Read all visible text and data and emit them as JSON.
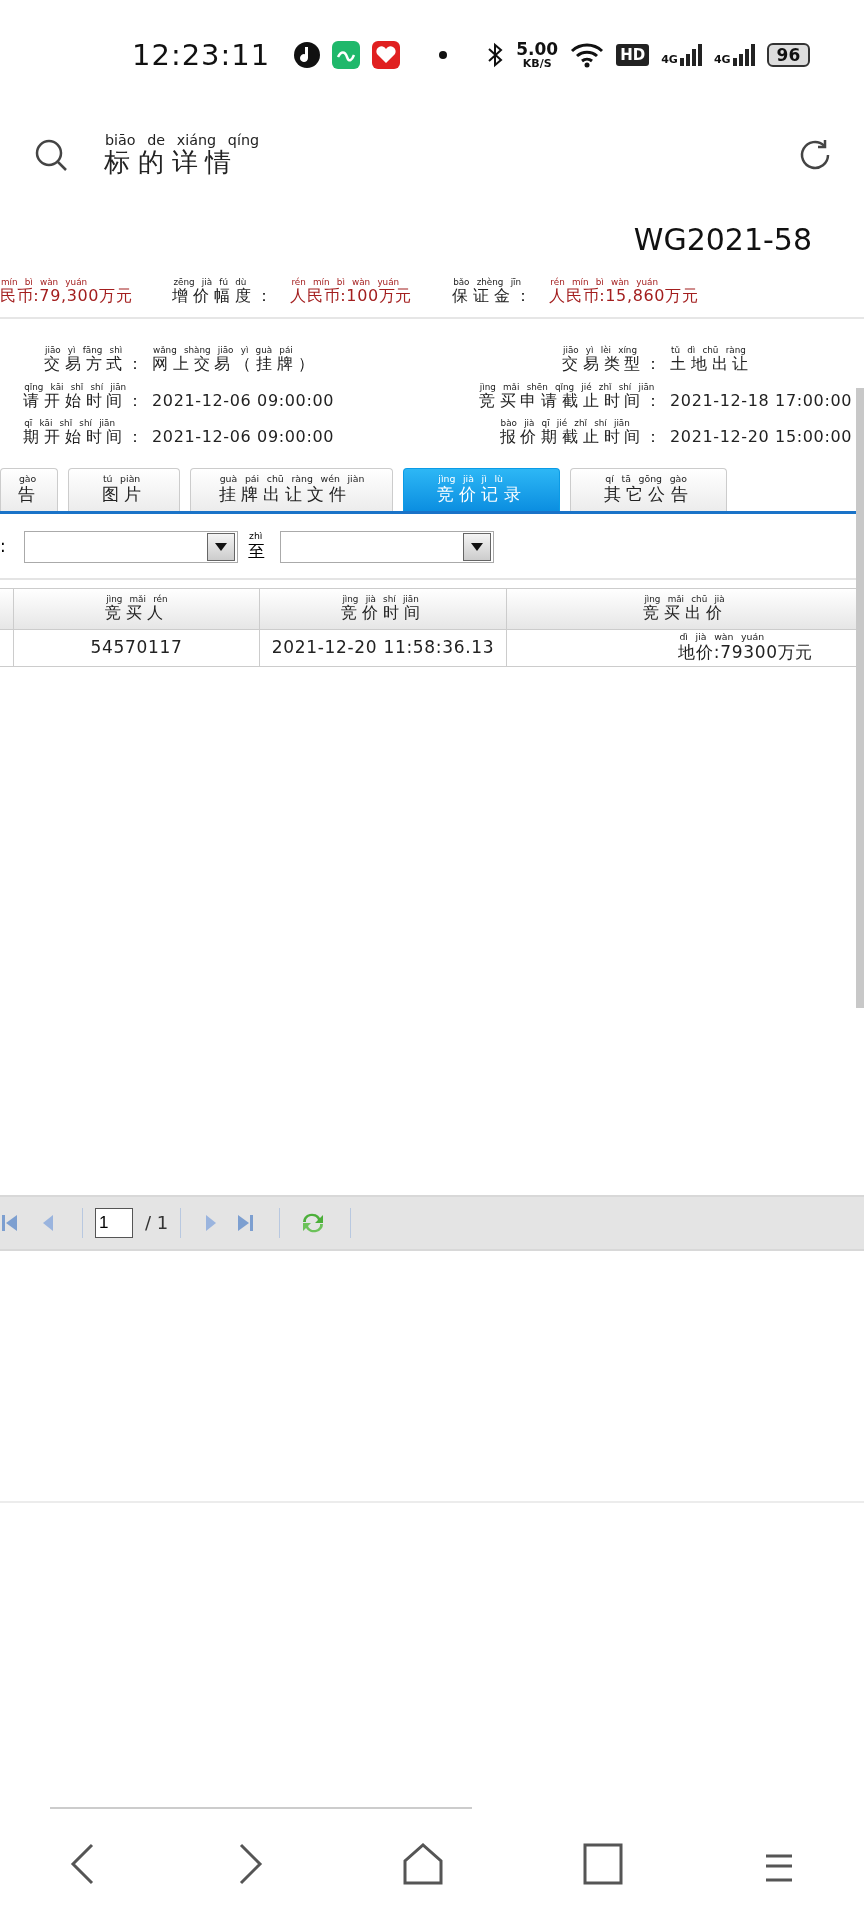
{
  "status_bar": {
    "time": "12:23:11",
    "net_speed": "5.00",
    "net_unit": "KB/S",
    "hd": "HD",
    "signals": [
      "4G",
      "4G"
    ],
    "battery": "96"
  },
  "header": {
    "title": {
      "text": "标的详情",
      "pinyin": "biāo de xiáng qíng"
    }
  },
  "lot_number": "WG2021-58",
  "prices": [
    {
      "value": {
        "text": "民币:79,300万元",
        "pinyin": "mín bì wàn yuán"
      }
    },
    {
      "label": {
        "text": "增价幅度：",
        "pinyin": "zēng jià fú dù"
      },
      "value": {
        "text": "人民币:100万元",
        "pinyin": "rén mín bì wàn yuán"
      }
    },
    {
      "label": {
        "text": "保证金：",
        "pinyin": "bǎo zhèng jīn"
      },
      "value": {
        "text": "人民币:15,860万元",
        "pinyin": "rén mín bì wàn yuán"
      }
    }
  ],
  "info": [
    {
      "label": {
        "text": "交易方式：",
        "pinyin": "jiāo yì fāng shì"
      },
      "value": {
        "text": "网上交易（挂牌）",
        "pinyin": "wǎng shàng jiāo yì guà pái"
      }
    },
    {
      "label": {
        "text": "交易类型：",
        "pinyin": "jiāo yì lèi xíng"
      },
      "value": {
        "text": "土地出让",
        "pinyin": "tǔ dì chū ràng"
      }
    },
    {
      "label": {
        "text": "请开始时间：",
        "pinyin": "qǐng kāi shǐ shí jiān"
      },
      "value": {
        "text": "2021-12-06 09:00:00"
      }
    },
    {
      "label": {
        "text": "竞买申请截止时间：",
        "pinyin": "jìng mǎi shēn qǐng jié zhǐ shí jiān"
      },
      "value": {
        "text": "2021-12-18 17:00:00"
      }
    },
    {
      "label": {
        "text": "期开始时间：",
        "pinyin": "qī kāi shǐ shí jiān"
      },
      "value": {
        "text": "2021-12-06 09:00:00"
      }
    },
    {
      "label": {
        "text": "报价期截止时间：",
        "pinyin": "bào jià qī jié zhǐ shí jiān"
      },
      "value": {
        "text": "2021-12-20 15:00:00"
      }
    }
  ],
  "tabs": [
    {
      "label": {
        "text": "告",
        "pinyin": "gào"
      },
      "selected": false
    },
    {
      "label": {
        "text": "图片",
        "pinyin": "tú piàn"
      },
      "selected": false
    },
    {
      "label": {
        "text": "挂牌出让文件",
        "pinyin": "guà pái chū ràng wén jiàn"
      },
      "selected": false
    },
    {
      "label": {
        "text": "竞价记录",
        "pinyin": "jìng jià jì lù"
      },
      "selected": true
    },
    {
      "label": {
        "text": "其它公告",
        "pinyin": "qí tā gōng gào"
      },
      "selected": false
    }
  ],
  "filter": {
    "label": {
      "text": ":"
    },
    "to_label": {
      "text": "至",
      "pinyin": "zhì"
    }
  },
  "table": {
    "columns": [
      {
        "text": "竞买人",
        "pinyin": "jìng mǎi rén"
      },
      {
        "text": "竞价时间",
        "pinyin": "jìng jià shí jiān"
      },
      {
        "text": "竞买出价",
        "pinyin": "jìng mǎi chū jià"
      }
    ],
    "rows": [
      {
        "cells": [
          {
            "text": "54570117"
          },
          {
            "text": "2021-12-20 11:58:36.13"
          },
          {
            "text": "地价:79300万元",
            "pinyin": "dì jià wàn yuán"
          }
        ]
      }
    ]
  },
  "pager": {
    "page": "1",
    "total": "/ 1"
  }
}
